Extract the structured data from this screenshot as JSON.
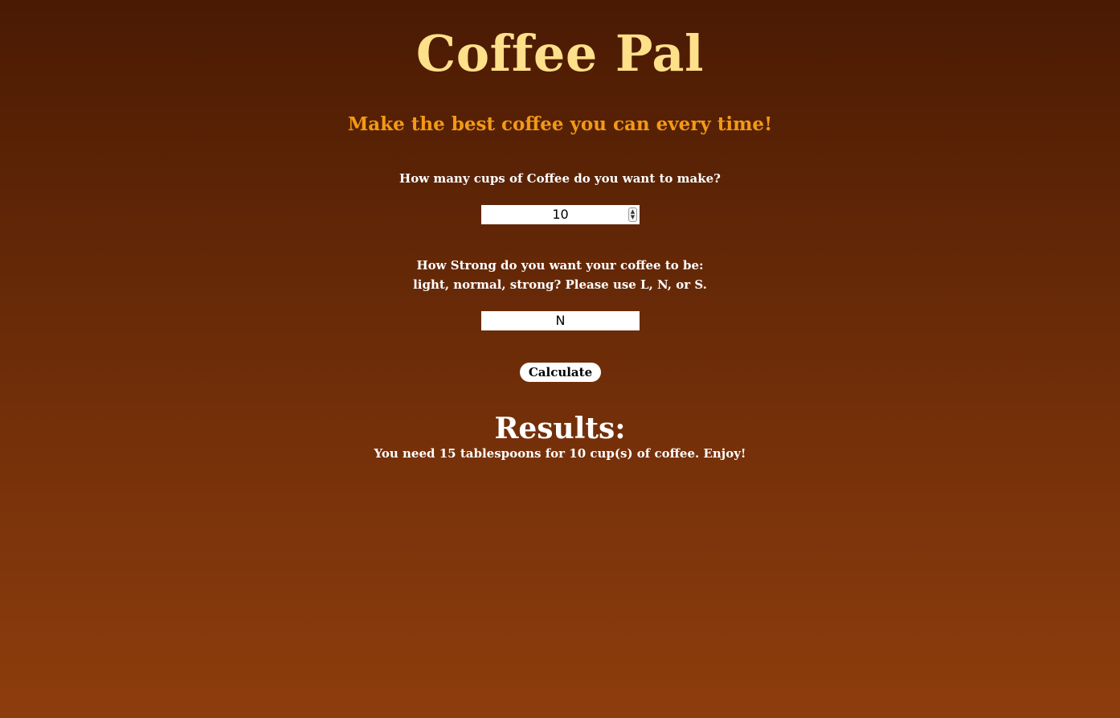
{
  "app": {
    "title": "Coffee Pal",
    "subtitle": "Make the best coffee you can every time!"
  },
  "form": {
    "cups_question": "How many cups of Coffee do you want to make?",
    "cups_value": "10",
    "strength_question_line1": "How Strong do you want your coffee to be:",
    "strength_question_line2": "light, normal, strong? Please use L, N, or S.",
    "strength_value": "N",
    "calculate_label": "Calculate"
  },
  "results": {
    "heading": "Results:",
    "message": "You need 15 tablespoons for 10 cup(s) of coffee. Enjoy!"
  },
  "icons": {
    "spinner_up": "▲",
    "spinner_down": "▼"
  },
  "colors": {
    "title": "#ffe08a",
    "subtitle": "#f39a14",
    "background_top": "#4a1a03",
    "background_bottom": "#8e3d0d"
  }
}
